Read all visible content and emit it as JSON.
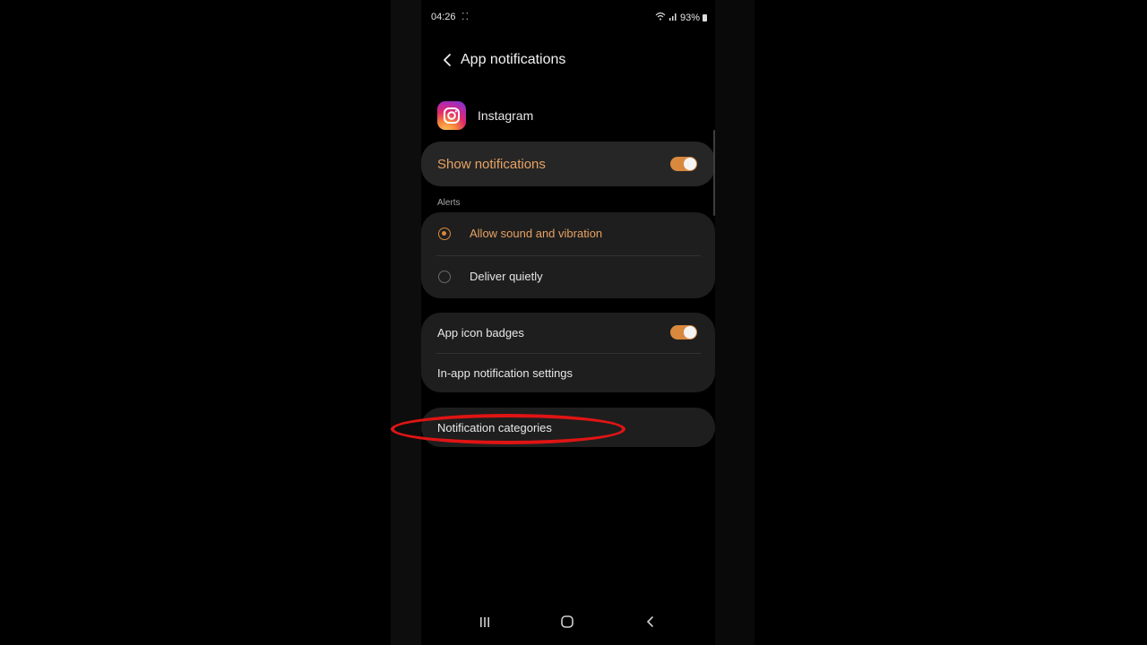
{
  "status_bar": {
    "time": "04:26",
    "notif_dots": "⁚⁚",
    "battery": "93%"
  },
  "header": {
    "title": "App notifications"
  },
  "app": {
    "name": "Instagram"
  },
  "show_notifications": {
    "label": "Show notifications",
    "enabled": true
  },
  "alerts": {
    "section_label": "Alerts",
    "options": [
      {
        "label": "Allow sound and vibration",
        "selected": true
      },
      {
        "label": "Deliver quietly",
        "selected": false
      }
    ]
  },
  "badges": {
    "label": "App icon badges",
    "enabled": true
  },
  "in_app": {
    "label": "In-app notification settings"
  },
  "categories": {
    "label": "Notification categories"
  },
  "colors": {
    "accent": "#d9893e",
    "highlight": "#e01414",
    "card": "#1e1e1e"
  }
}
